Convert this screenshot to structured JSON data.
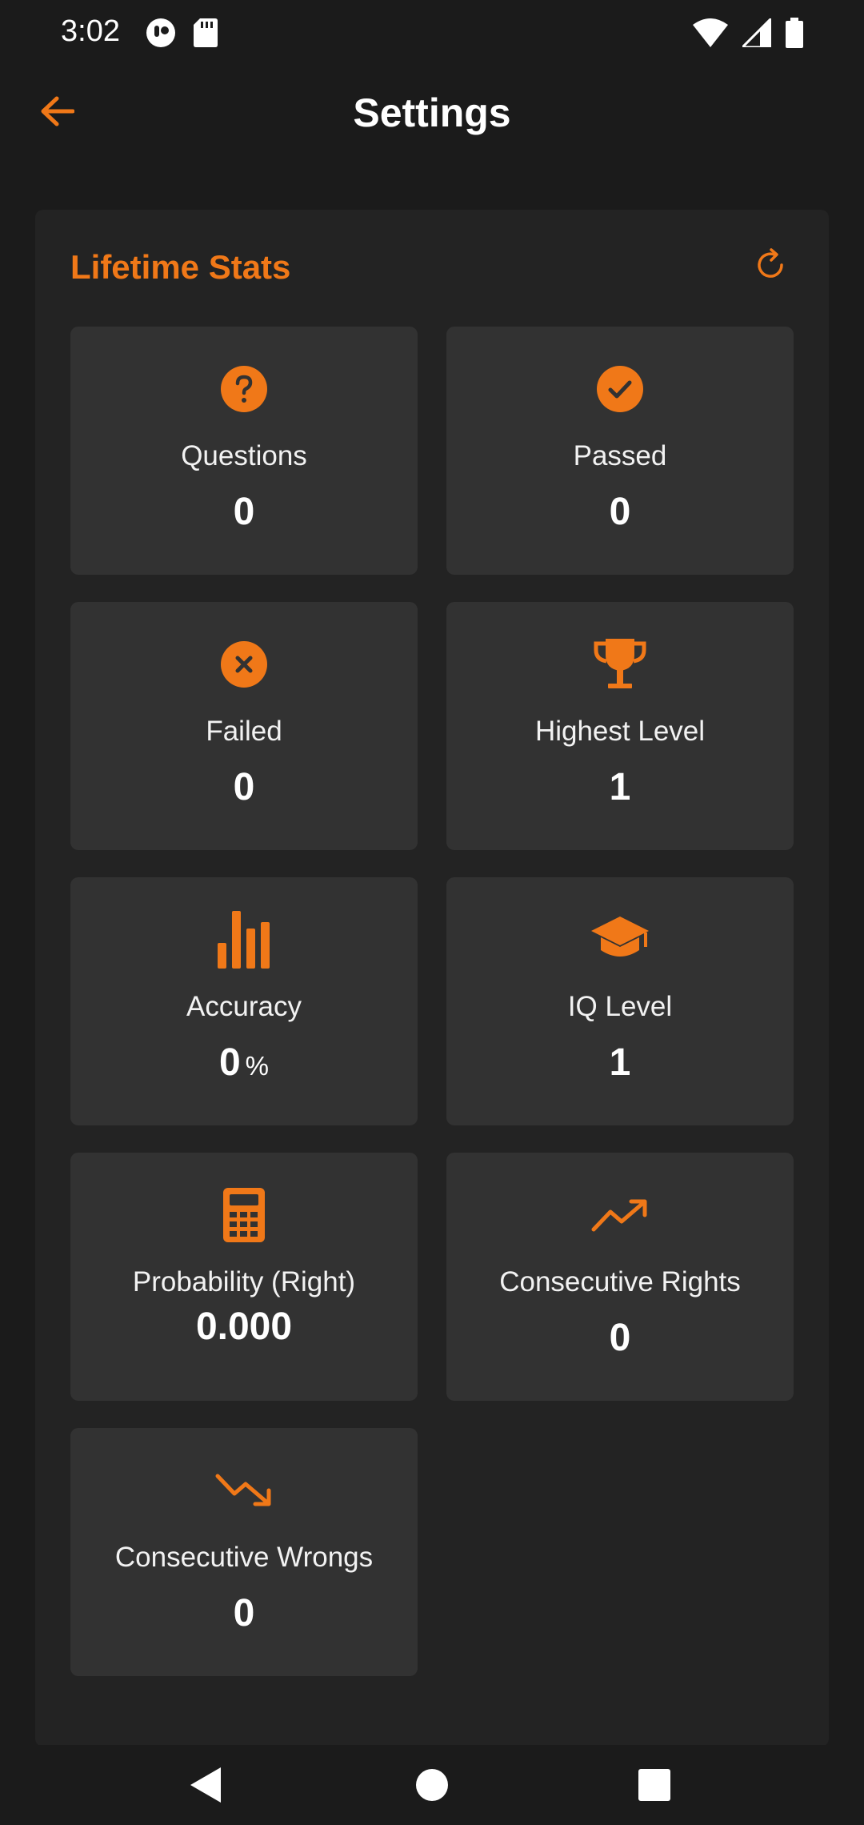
{
  "status_bar": {
    "time": "3:02",
    "icons": [
      "app-notification-icon",
      "sd-card-icon",
      "wifi-icon",
      "cellular-signal-icon",
      "battery-icon"
    ]
  },
  "app_bar": {
    "title": "Settings",
    "back_icon": "arrow-back-icon"
  },
  "colors": {
    "accent": "#f07818",
    "background": "#1b1b1b",
    "card": "#232323",
    "tile": "#323232",
    "text": "#ffffff"
  },
  "lifetime_stats": {
    "title": "Lifetime Stats",
    "refresh_icon": "refresh-icon",
    "tiles": [
      {
        "icon": "question-circle-icon",
        "label": "Questions",
        "value": "0",
        "unit": ""
      },
      {
        "icon": "check-circle-icon",
        "label": "Passed",
        "value": "0",
        "unit": ""
      },
      {
        "icon": "x-circle-icon",
        "label": "Failed",
        "value": "0",
        "unit": ""
      },
      {
        "icon": "trophy-icon",
        "label": "Highest Level",
        "value": "1",
        "unit": ""
      },
      {
        "icon": "bar-chart-icon",
        "label": "Accuracy",
        "value": "0",
        "unit": "%"
      },
      {
        "icon": "graduation-cap-icon",
        "label": "IQ Level",
        "value": "1",
        "unit": ""
      },
      {
        "icon": "calculator-icon",
        "label": "Probability (Right)",
        "value": "0.000",
        "unit": ""
      },
      {
        "icon": "trending-up-icon",
        "label": "Consecutive Rights",
        "value": "0",
        "unit": ""
      },
      {
        "icon": "trending-down-icon",
        "label": "Consecutive Wrongs",
        "value": "0",
        "unit": ""
      }
    ]
  },
  "nav_bar": {
    "icons": [
      "nav-back-icon",
      "nav-home-icon",
      "nav-recents-icon"
    ]
  }
}
